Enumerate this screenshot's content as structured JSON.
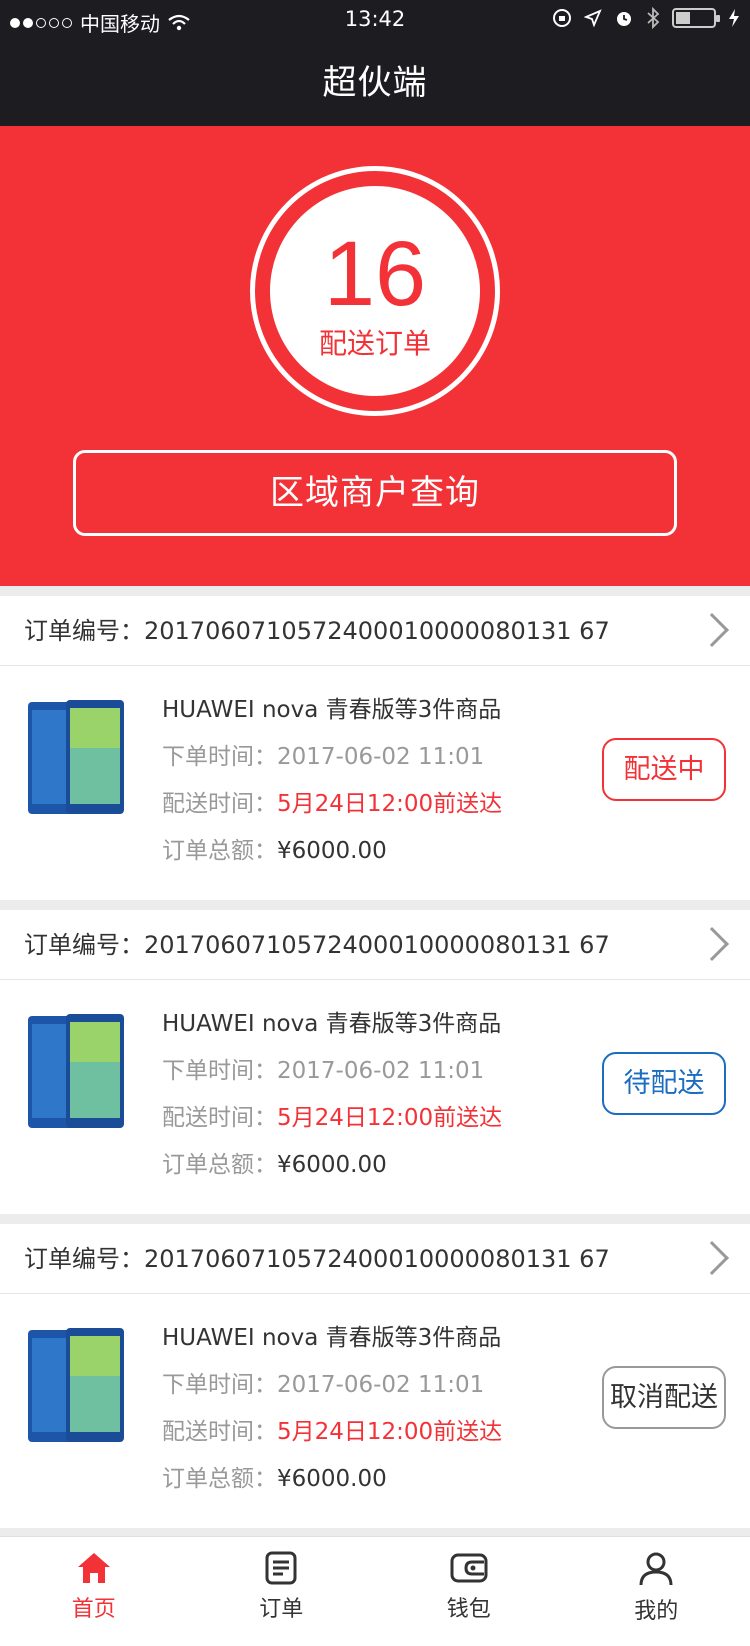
{
  "status_bar": {
    "carrier": "中国移动",
    "time": "13:42"
  },
  "nav": {
    "title": "超伙端"
  },
  "hero": {
    "count": "16",
    "count_label": "配送订单",
    "query_button": "区域商户查询"
  },
  "labels": {
    "order_no": "订单编号：",
    "order_time": "下单时间：",
    "delivery_time": "配送时间：",
    "total": "订单总额："
  },
  "orders": [
    {
      "order_no": "2017060710572400010000080131 67",
      "product": "HUAWEI nova 青春版等3件商品",
      "order_time": "2017-06-02 11:01",
      "delivery_time": "5月24日12:00前送达",
      "total": "¥6000.00",
      "status": "配送中"
    },
    {
      "order_no": "2017060710572400010000080131 67",
      "product": "HUAWEI nova 青春版等3件商品",
      "order_time": "2017-06-02 11:01",
      "delivery_time": "5月24日12:00前送达",
      "total": "¥6000.00",
      "status": "待配送"
    },
    {
      "order_no": "2017060710572400010000080131 67",
      "product": "HUAWEI nova 青春版等3件商品",
      "order_time": "2017-06-02 11:01",
      "delivery_time": "5月24日12:00前送达",
      "total": "¥6000.00",
      "status": "取消配送"
    }
  ],
  "tabs": [
    {
      "label": "首页",
      "icon": "home-icon"
    },
    {
      "label": "订单",
      "icon": "order-icon"
    },
    {
      "label": "钱包",
      "icon": "wallet-icon"
    },
    {
      "label": "我的",
      "icon": "user-icon"
    }
  ],
  "colors": {
    "accent": "#f23237",
    "blue": "#1a6dbf",
    "dark": "#1c1c21"
  }
}
